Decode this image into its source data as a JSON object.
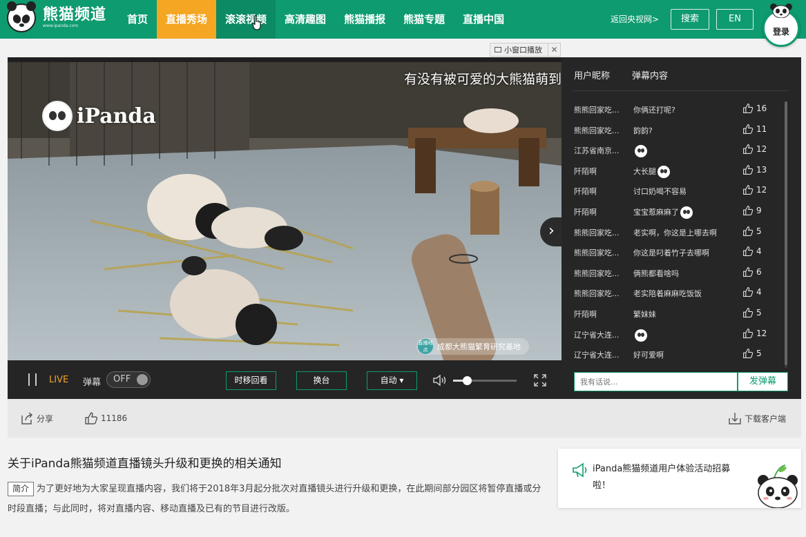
{
  "site": {
    "logo_text": "熊猫频道",
    "logo_sub": "www.ipanda.com"
  },
  "nav": {
    "items": [
      {
        "label": "首页"
      },
      {
        "label": "直播秀场"
      },
      {
        "label": "滚滚视频"
      },
      {
        "label": "高清趣图"
      },
      {
        "label": "熊猫播报"
      },
      {
        "label": "熊猫专题"
      },
      {
        "label": "直播中国"
      }
    ],
    "active_index": 1,
    "hover_index": 2,
    "back_link": "返回央视网>",
    "search_label": "搜索",
    "lang_label": "EN",
    "login_label": "登录"
  },
  "pip": {
    "label": "小窗口播放",
    "close": "✕"
  },
  "player": {
    "overlay_text": "有没有被可爱的大熊猫萌到",
    "watermark": "iPanda",
    "location_icon_text": "直播地点",
    "location": "成都大熊猫繁育研究基地",
    "live_label": "LIVE",
    "danmu_label": "弹幕",
    "danmu_toggle": "OFF",
    "btn_timeshift": "时移回看",
    "btn_switch": "换台",
    "btn_quality": "自动 ▾",
    "volume_level": 0.22,
    "colors": {
      "accent": "#0e9b70",
      "live": "#f5a623"
    }
  },
  "chat": {
    "col_user": "用户昵称",
    "col_content": "弹幕内容",
    "messages": [
      {
        "user": "熊熊回家吃...",
        "text": "你俩还打呢?",
        "emoji": false,
        "likes": "16"
      },
      {
        "user": "熊熊回家吃...",
        "text": "韵韵?",
        "emoji": false,
        "likes": "11"
      },
      {
        "user": "江苏省南京...",
        "text": "",
        "emoji": true,
        "likes": "12"
      },
      {
        "user": "阡陌啊",
        "text": "大长腿",
        "emoji": true,
        "likes": "13"
      },
      {
        "user": "阡陌啊",
        "text": "讨口奶喝不容易",
        "emoji": false,
        "likes": "12"
      },
      {
        "user": "阡陌啊",
        "text": "宝宝惹麻麻了",
        "emoji": true,
        "likes": "9"
      },
      {
        "user": "熊熊回家吃...",
        "text": "老实啊，你这是上哪去啊",
        "emoji": false,
        "likes": "5"
      },
      {
        "user": "熊熊回家吃...",
        "text": "你这是叼着竹子去哪啊",
        "emoji": false,
        "likes": "4"
      },
      {
        "user": "熊熊回家吃...",
        "text": "俩熊都看啥吗",
        "emoji": false,
        "likes": "6"
      },
      {
        "user": "熊熊回家吃...",
        "text": "老实陪着麻麻吃饭饭",
        "emoji": false,
        "likes": "4"
      },
      {
        "user": "阡陌啊",
        "text": "繁妹妹",
        "emoji": false,
        "likes": "5"
      },
      {
        "user": "辽宁省大连...",
        "text": "",
        "emoji": true,
        "likes": "12"
      },
      {
        "user": "辽宁省大连...",
        "text": "好可爱啊",
        "emoji": false,
        "likes": "5"
      }
    ],
    "input_placeholder": "我有话说...",
    "send_label": "发弹幕"
  },
  "actions": {
    "share_label": "分享",
    "like_count": "11186",
    "download_label": "下载客户端"
  },
  "article": {
    "title": "关于iPanda熊猫频道直播镜头升级和更换的相关通知",
    "tag": "简介",
    "body": "为了更好地为大家呈现直播内容，我们将于2018年3月起分批次对直播镜头进行升级和更换，在此期间部分园区将暂停直播或分时段直播；与此同时，将对直播内容、移动直播及已有的节目进行改版。"
  },
  "promo": {
    "text": "iPanda熊猫频道用户体验活动招募啦！"
  }
}
